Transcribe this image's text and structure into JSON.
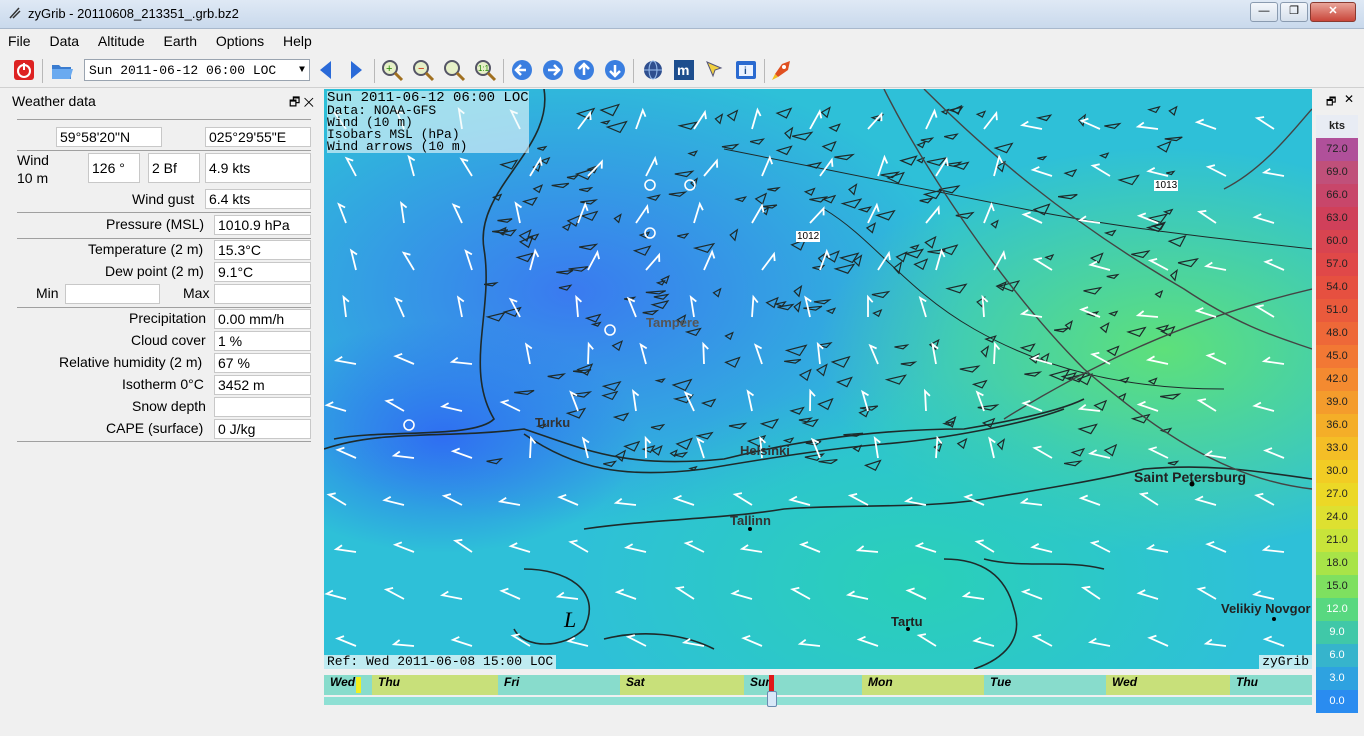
{
  "window": {
    "title": "zyGrib - 20110608_213351_.grb.bz2",
    "minimize": "—",
    "maximize": "❐",
    "close": "✕"
  },
  "menu": [
    "File",
    "Data",
    "Altitude",
    "Earth",
    "Options",
    "Help"
  ],
  "toolbar": {
    "date_value": "Sun 2011-06-12 06:00 LOC"
  },
  "weather_panel": {
    "title": "Weather data",
    "lat": "59°58'20\"N",
    "lon": "025°29'55\"E",
    "wind_label_1": "Wind",
    "wind_label_2": "10 m",
    "wind_dir": "126 °",
    "wind_bf": "2 Bf",
    "wind_speed": "4.9  kts",
    "gust_label": "Wind gust",
    "gust_value": "6.4  kts",
    "pressure_label": "Pressure (MSL)",
    "pressure_value": "1010.9 hPa",
    "temp_label": "Temperature (2 m)",
    "temp_value": "15.3°C",
    "dew_label": "Dew point (2 m)",
    "dew_value": "9.1°C",
    "min_label": "Min",
    "max_label": "Max",
    "precip_label": "Precipitation",
    "precip_value": "0.00 mm/h",
    "cloud_label": "Cloud cover",
    "cloud_value": " 1 %",
    "rh_label": "Relative humidity (2 m)",
    "rh_value": "67 %",
    "iso_label": "Isotherm 0°C",
    "iso_value": "3452 m",
    "snow_label": "Snow depth",
    "snow_value": "",
    "cape_label": "CAPE (surface)",
    "cape_value": "0 J/kg"
  },
  "map": {
    "header_lines": [
      "Sun 2011-06-12 06:00 LOC",
      "Data: NOAA-GFS",
      "Wind (10 m)",
      "Isobars MSL (hPa)",
      "Wind arrows (10 m)"
    ],
    "ref": "Ref: Wed 2011-06-08 15:00 LOC",
    "brand": "zyGrib",
    "cities": [
      "Tampere",
      "Turku",
      "Helsinki",
      "Tallinn",
      "Saint Petersburg",
      "Tartu",
      "Velikiy Novgor"
    ],
    "isobars": [
      "1012",
      "1013"
    ],
    "low_marker": "L"
  },
  "timeline": {
    "days": [
      "Wed",
      "Thu",
      "Fri",
      "Sat",
      "Sun",
      "Mon",
      "Tue",
      "Wed",
      "Thu"
    ]
  },
  "color_scale": {
    "unit": "kts",
    "values": [
      "72.0",
      "69.0",
      "66.0",
      "63.0",
      "60.0",
      "57.0",
      "54.0",
      "51.0",
      "48.0",
      "45.0",
      "42.0",
      "39.0",
      "36.0",
      "33.0",
      "30.0",
      "27.0",
      "24.0",
      "21.0",
      "18.0",
      "15.0",
      "12.0",
      "9.0",
      "6.0",
      "3.0",
      "0.0"
    ],
    "colors": [
      "#b0509a",
      "#c0507a",
      "#c8466a",
      "#d0405a",
      "#d84450",
      "#e04848",
      "#e65040",
      "#ea5a3c",
      "#ee6838",
      "#f27834",
      "#f48a30",
      "#f49c2c",
      "#f4ae28",
      "#f4be26",
      "#f2cc24",
      "#ecd826",
      "#dee030",
      "#c8e43a",
      "#a8e448",
      "#7ee060",
      "#58d880",
      "#40c8a8",
      "#36b4cc",
      "#2ea2e0",
      "#2a8cf0"
    ]
  }
}
